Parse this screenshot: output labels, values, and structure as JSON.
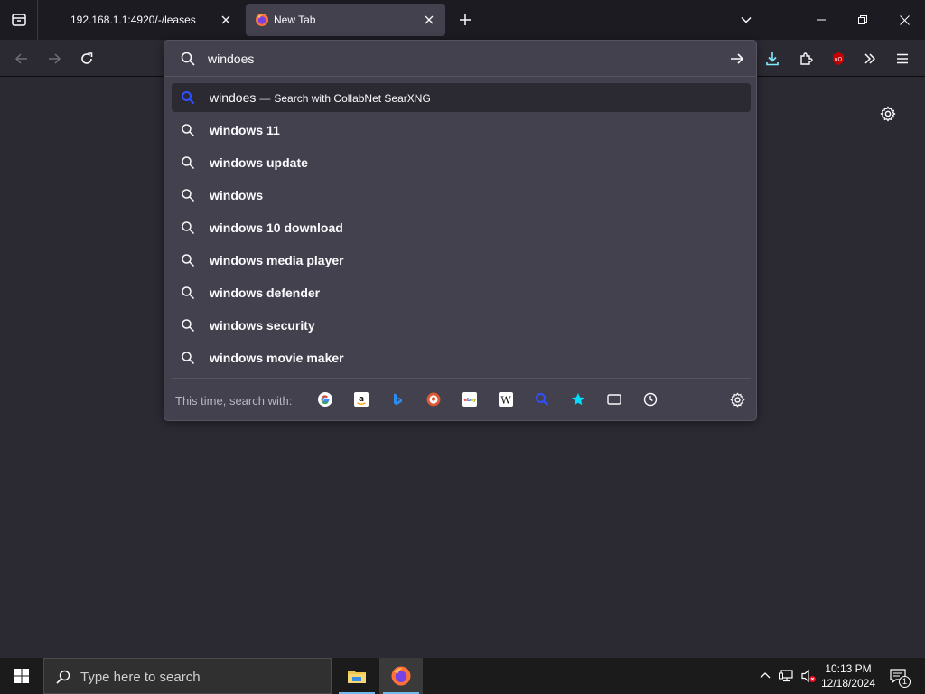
{
  "tabs": [
    {
      "title": "192.168.1.1:4920/-/leases",
      "active": false
    },
    {
      "title": "New Tab",
      "active": true
    }
  ],
  "urlbar": {
    "value": "windoes",
    "heuristic": {
      "query": "windoes",
      "separator": "—",
      "action": "Search with CollabNet SearXNG"
    },
    "suggestions": [
      "windows 11",
      "windows update",
      "windows",
      "windows 10 download",
      "windows media player",
      "windows defender",
      "windows security",
      "windows movie maker"
    ],
    "oneoff_label": "This time, search with:",
    "engines": [
      {
        "icon": "google-icon"
      },
      {
        "icon": "amazon-icon"
      },
      {
        "icon": "bing-icon"
      },
      {
        "icon": "duckduckgo-icon"
      },
      {
        "icon": "ebay-icon"
      },
      {
        "icon": "wikipedia-icon"
      },
      {
        "icon": "searxng-icon"
      },
      {
        "icon": "bookmarks-icon"
      },
      {
        "icon": "tabs-icon"
      },
      {
        "icon": "history-icon"
      }
    ]
  },
  "taskbar": {
    "search_placeholder": "Type here to search",
    "time": "10:13 PM",
    "date": "12/18/2024",
    "notification_count": "1"
  },
  "colors": {
    "accent": "#0060df",
    "tab_active": "#42414d",
    "taskbar_accent": "#76b9ed"
  }
}
